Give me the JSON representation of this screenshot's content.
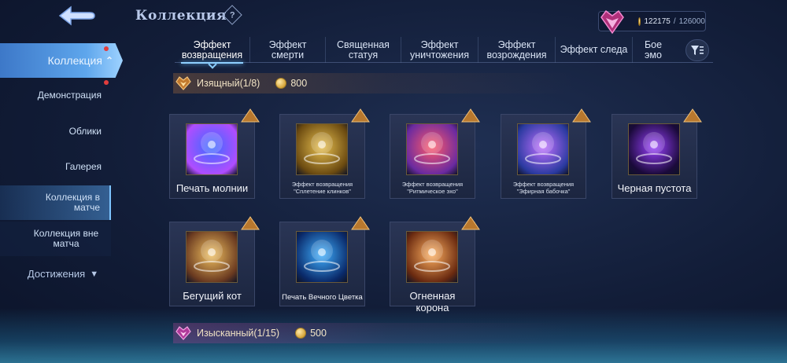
{
  "header": {
    "title": "Коллекция",
    "help_symbol": "?",
    "currency": {
      "current": "122175",
      "separator": "/",
      "max": "126000"
    }
  },
  "sidebar": {
    "active": "Коллекция",
    "items": [
      {
        "label": "Демонстрация"
      },
      {
        "label": "Облики"
      },
      {
        "label": "Галерея"
      },
      {
        "label": "Коллекция в матче"
      },
      {
        "label": "Коллекция вне матча"
      }
    ],
    "achievements": "Достижения"
  },
  "tabs": [
    {
      "label": "Эффект возвращения",
      "active": true
    },
    {
      "label": "Эффект смерти"
    },
    {
      "label": "Священная статуя"
    },
    {
      "label": "Эффект уничтожения"
    },
    {
      "label": "Эффект возрождения"
    },
    {
      "label": "Эффект следа"
    },
    {
      "label": "Бое эмо"
    }
  ],
  "sections": [
    {
      "title": "Изящный(1/8)",
      "price": "800",
      "accent": "#e0a050",
      "items": [
        {
          "label": "Печать молнии",
          "art": "lightning-seal",
          "colors": [
            "#3a6cff",
            "#b04dff"
          ]
        },
        {
          "label": "Эффект возвращения \"Сплетение клинков\"",
          "art": "blades",
          "colors": [
            "#e8c050",
            "#6b4a10"
          ]
        },
        {
          "label": "Эффект возвращения \"Ритмическое эхо\"",
          "art": "rhythm-echo",
          "colors": [
            "#ff5a6a",
            "#6a2aa0"
          ]
        },
        {
          "label": "Эффект возвращения \"Эфирная бабочка\"",
          "art": "butterfly",
          "colors": [
            "#c070ff",
            "#2a3aa0"
          ]
        },
        {
          "label": "Черная пустота",
          "art": "black-void",
          "colors": [
            "#9a40ff",
            "#1a0a3a"
          ]
        },
        {
          "label": "Бегущий кот",
          "art": "running-cat",
          "colors": [
            "#f0c060",
            "#6a3a20"
          ]
        },
        {
          "label": "Печать Вечного Цветка",
          "art": "eternal-flower",
          "colors": [
            "#40b0ff",
            "#0a2a6a"
          ]
        },
        {
          "label": "Огненная корона",
          "art": "fire-crown",
          "colors": [
            "#ffb060",
            "#6a2a10"
          ]
        }
      ]
    },
    {
      "title": "Изысканный(1/15)",
      "price": "500",
      "accent": "#d060c0"
    }
  ]
}
